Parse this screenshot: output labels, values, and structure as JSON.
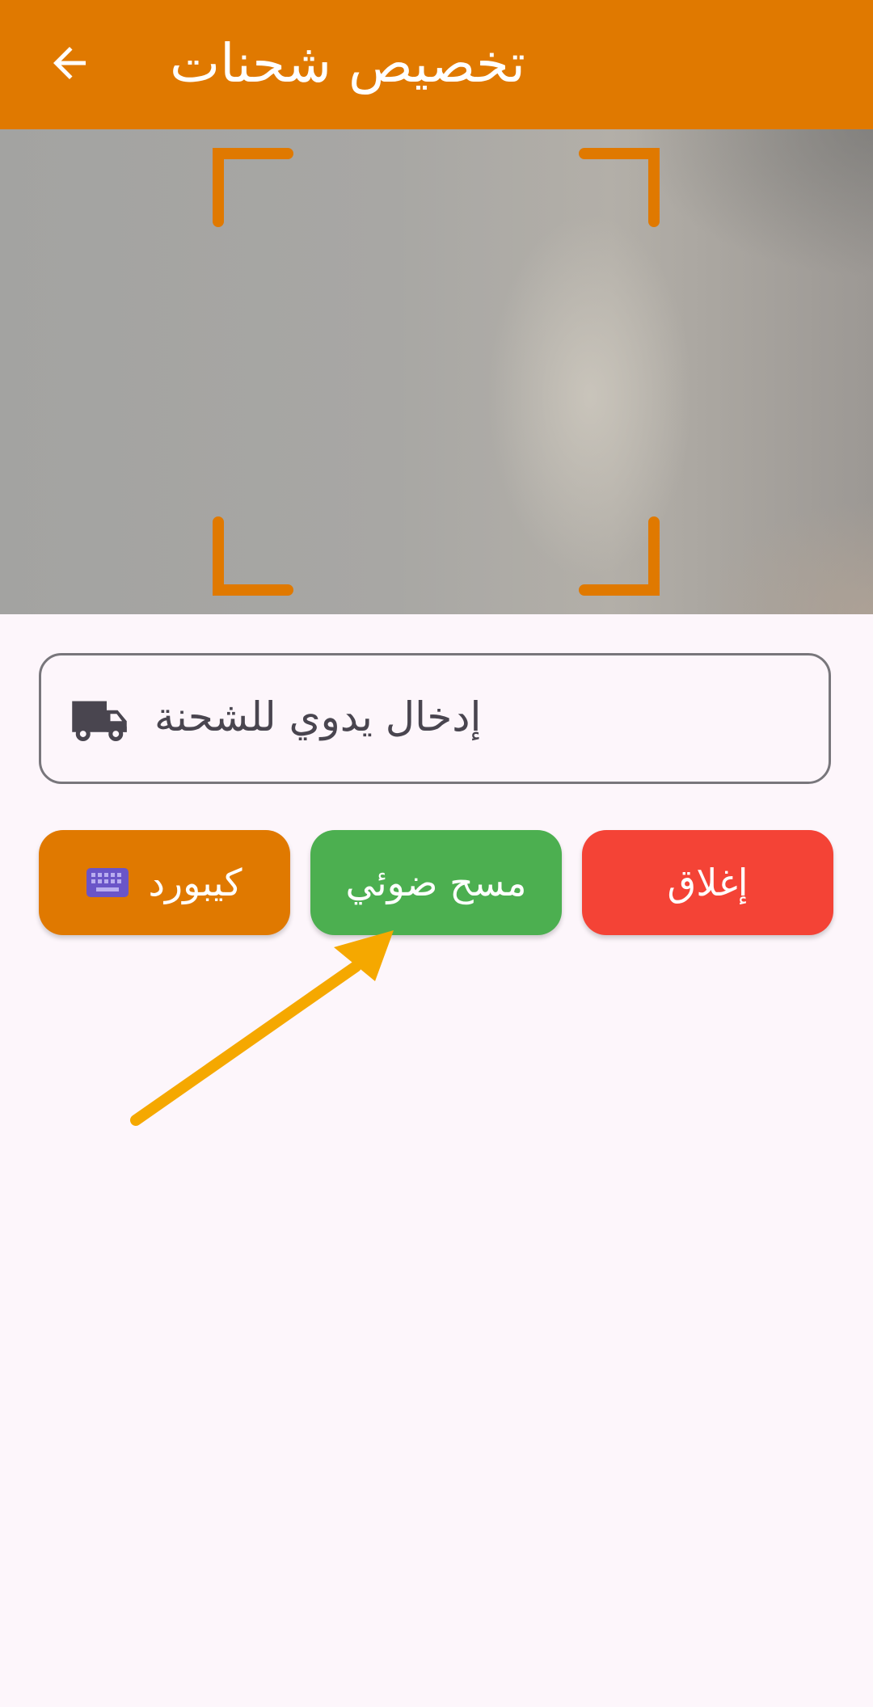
{
  "appbar": {
    "title": "تخصيص شحنات",
    "back_icon": "arrow-back-icon"
  },
  "camera": {
    "frame_color": "#e07900"
  },
  "manual_entry": {
    "label": "إدخال يدوي للشحنة",
    "icon": "truck-icon"
  },
  "buttons": {
    "keyboard_label": "كيبورد",
    "keyboard_icon": "keyboard-icon",
    "scan_label": "مسح ضوئي",
    "close_label": "إغلاق"
  },
  "colors": {
    "primary": "#e07900",
    "scan": "#4caf50",
    "close": "#f44336",
    "annotation_arrow": "#f5a800"
  }
}
